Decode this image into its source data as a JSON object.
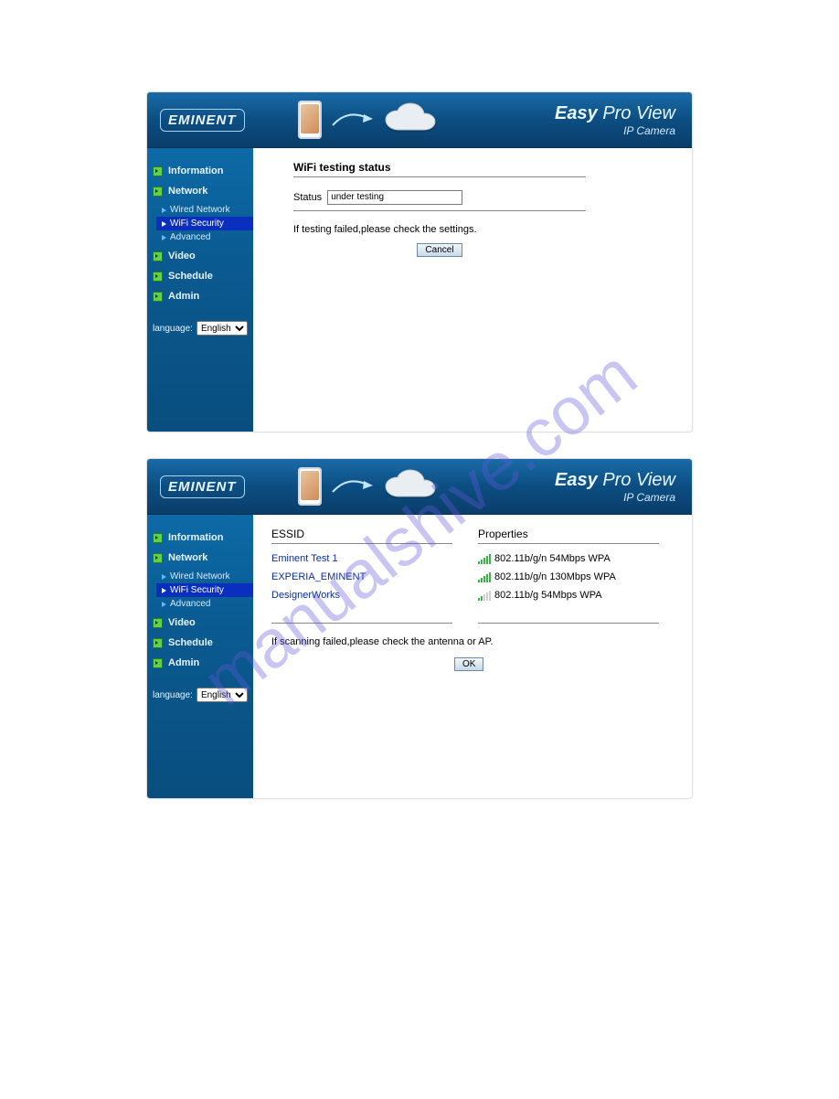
{
  "watermark": "manualshive.com",
  "brand": {
    "logo": "EMINENT",
    "title_strong": "Easy",
    "title_light": "Pro View",
    "subtitle": "IP Camera"
  },
  "sidebar": {
    "items": {
      "information": "Information",
      "network": "Network",
      "video": "Video",
      "schedule": "Schedule",
      "admin": "Admin"
    },
    "network_sub": {
      "wired": "Wired Network",
      "wifi": "WiFi Security",
      "advanced": "Advanced"
    },
    "language_label": "language:",
    "language_value": "English"
  },
  "panel1": {
    "title": "WiFi testing status",
    "status_label": "Status",
    "status_value": "under testing",
    "hint": "If testing failed,please check the settings.",
    "cancel": "Cancel"
  },
  "panel2": {
    "essid_header": "ESSID",
    "props_header": "Properties",
    "networks": {
      "n0": {
        "essid": "Eminent Test 1",
        "props": "802.11b/g/n 54Mbps WPA"
      },
      "n1": {
        "essid": "EXPERIA_EMINENT",
        "props": "802.11b/g/n 130Mbps WPA"
      },
      "n2": {
        "essid": "DesignerWorks",
        "props": "802.11b/g 54Mbps WPA"
      }
    },
    "hint": "If scanning failed,please check the antenna or AP.",
    "ok": "OK"
  }
}
